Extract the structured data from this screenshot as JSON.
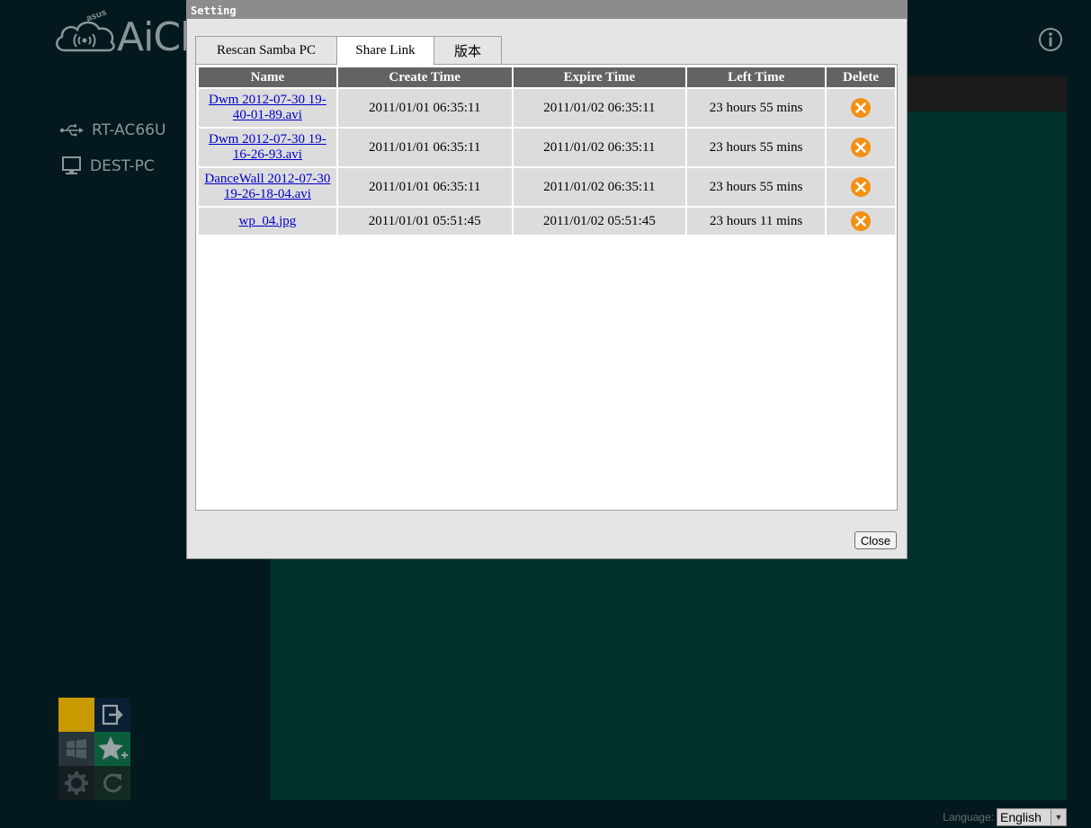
{
  "app": {
    "brand": "AiCl",
    "brand_small": "asus"
  },
  "devices": [
    {
      "label": "RT-AC66U",
      "icon": "usb-icon"
    },
    {
      "label": "DEST-PC",
      "icon": "monitor-icon"
    }
  ],
  "language": {
    "label": "Language:",
    "selected": "English"
  },
  "modal": {
    "title": "Setting",
    "tabs": [
      {
        "label": "Rescan Samba PC",
        "active": false
      },
      {
        "label": "Share Link",
        "active": true
      },
      {
        "label": "版本",
        "active": false
      }
    ],
    "table": {
      "headers": [
        "Name",
        "Create Time",
        "Expire Time",
        "Left Time",
        "Delete"
      ],
      "rows": [
        {
          "name_line1": "Dwm 2012-07-30 19-",
          "name_line2": "40-01-89.avi",
          "create": "2011/01/01 06:35:11",
          "expire": "2011/01/02 06:35:11",
          "left": "23 hours 55 mins"
        },
        {
          "name_line1": "Dwm 2012-07-30 19-",
          "name_line2": "16-26-93.avi",
          "create": "2011/01/01 06:35:11",
          "expire": "2011/01/02 06:35:11",
          "left": "23 hours 55 mins"
        },
        {
          "name_line1": "DanceWall 2012-07-30",
          "name_line2": "19-26-18-04.avi",
          "create": "2011/01/01 06:35:11",
          "expire": "2011/01/02 06:35:11",
          "left": "23 hours 55 mins"
        },
        {
          "name_line1": "wp_04.jpg",
          "name_line2": "",
          "create": "2011/01/01 05:51:45",
          "expire": "2011/01/02 05:51:45",
          "left": "23 hours 11 mins"
        }
      ]
    },
    "close_label": "Close"
  },
  "colors": {
    "background": "#03191d",
    "content_panel": "#02302a",
    "delete_icon": "#f39012",
    "tile_gold": "#c79a00",
    "tile_green": "#0c5c3c"
  }
}
